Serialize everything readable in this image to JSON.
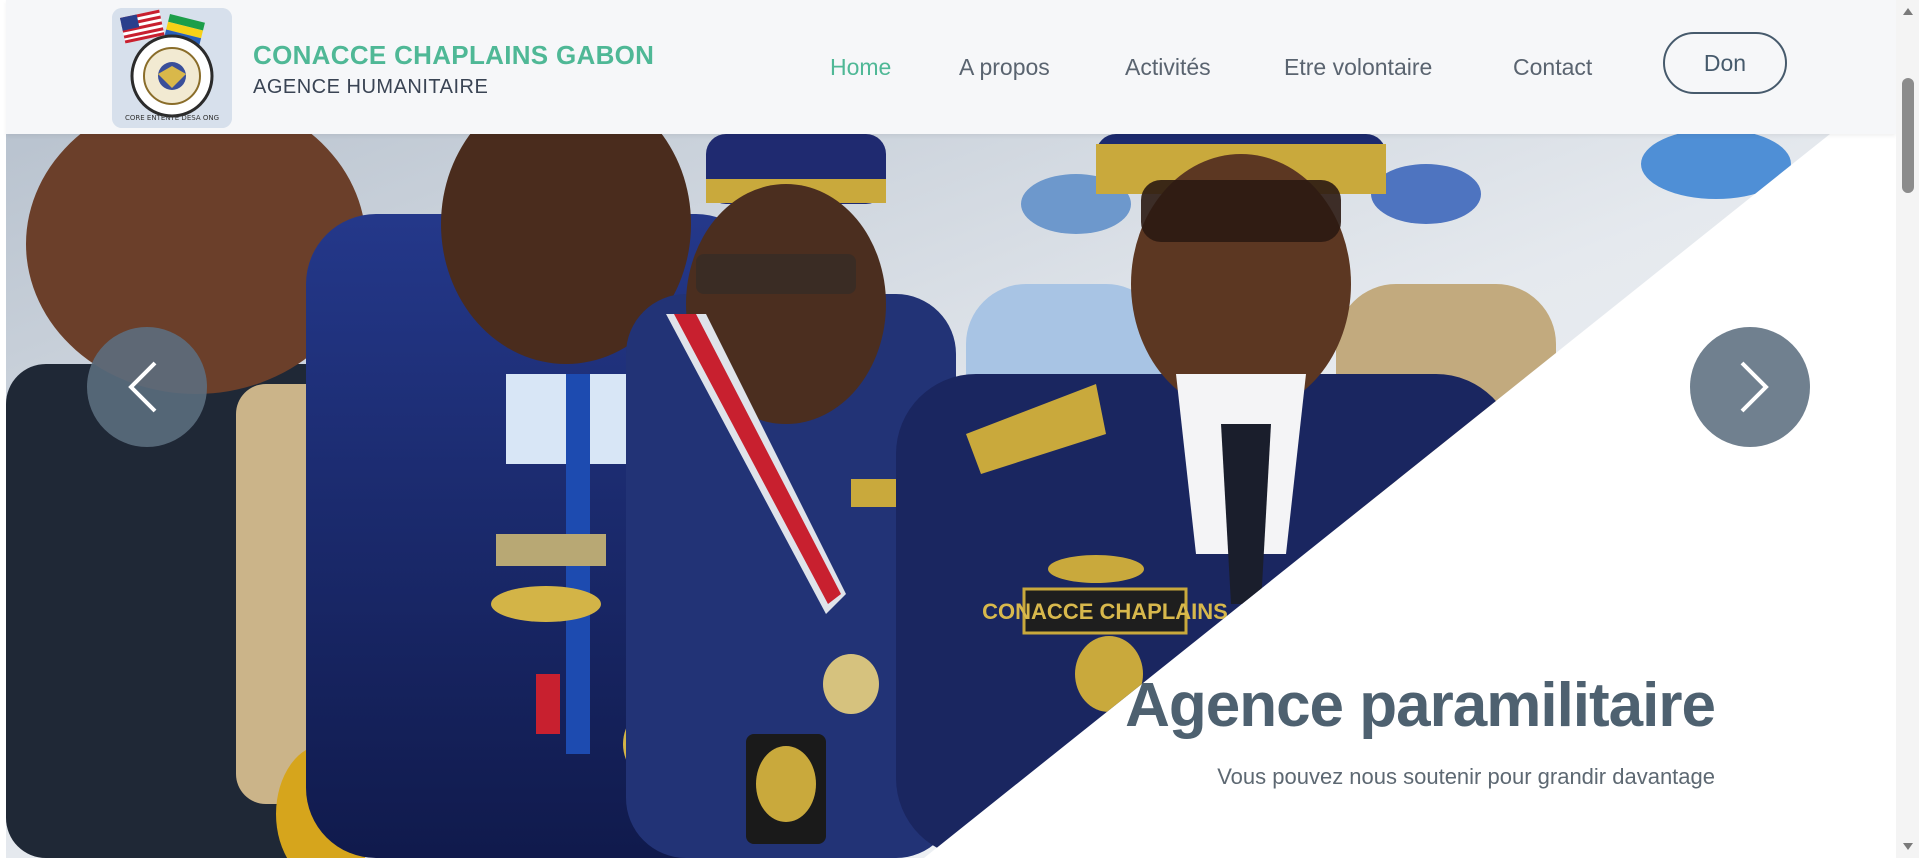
{
  "header": {
    "brand_name": "CONACCE CHAPLAINS GABON",
    "brand_tagline": "AGENCE HUMANITAIRE",
    "logo_ring_text": "CONACCE CHAPLAINS",
    "logo_bottom_text": "CORE ENTENTE DESA ONG",
    "nav": [
      {
        "label": "Home",
        "active": true
      },
      {
        "label": "A propos",
        "active": false
      },
      {
        "label": "Activités",
        "active": false
      },
      {
        "label": "Etre volontaire",
        "active": false
      },
      {
        "label": "Contact",
        "active": false
      }
    ],
    "donate_label": "Don"
  },
  "hero": {
    "title": "Agence paramilitaire",
    "subtitle": "Vous pouvez nous soutenir pour grandir davantage",
    "badge_text": "CONACCE CHAPLAINS",
    "prev_icon": "chevron-left-icon",
    "next_icon": "chevron-right-icon"
  },
  "colors": {
    "accent": "#4fb896",
    "nav_text": "#5a6470",
    "title": "#4e6170",
    "arrow_bg": "#5c6e80",
    "uniform": "#1c2e78"
  }
}
